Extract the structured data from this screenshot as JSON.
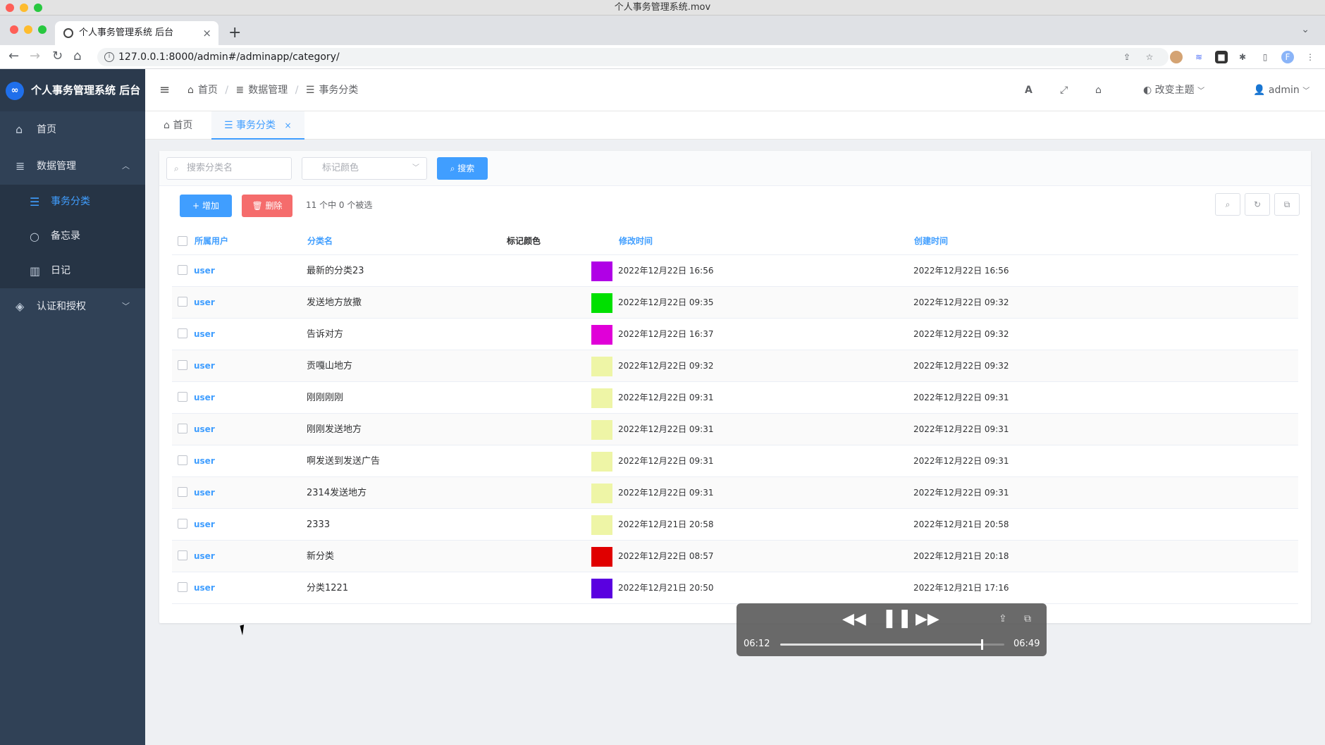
{
  "window": {
    "title": "个人事务管理系统.mov"
  },
  "browser": {
    "tab_title": "个人事务管理系统 后台",
    "url": "127.0.0.1:8000/admin#/adminapp/category/"
  },
  "app": {
    "logo_text": "个人事务管理系统 后台",
    "sidebar": {
      "items": [
        {
          "label": "首页",
          "icon": "home-icon"
        },
        {
          "label": "数据管理",
          "icon": "database-icon",
          "expanded": true,
          "children": [
            {
              "label": "事务分类",
              "icon": "list-icon",
              "active": true
            },
            {
              "label": "备忘录",
              "icon": "circle-icon"
            },
            {
              "label": "日记",
              "icon": "book-icon"
            }
          ]
        },
        {
          "label": "认证和授权",
          "icon": "shield-icon"
        }
      ]
    },
    "breadcrumb": [
      "首页",
      "数据管理",
      "事务分类"
    ],
    "header_right": {
      "theme_label": "改变主题",
      "user": "admin",
      "font_icon": "A"
    },
    "tags": [
      {
        "label": "首页"
      },
      {
        "label": "事务分类",
        "active": true
      }
    ],
    "filters": {
      "search_placeholder": "搜索分类名",
      "color_placeholder": "标记颜色",
      "search_button": "搜索"
    },
    "actions": {
      "add": "增加",
      "delete": "删除",
      "selection_info": "11 个中 0 个被选"
    },
    "table": {
      "headers": [
        "所属用户",
        "分类名",
        "标记颜色",
        "修改时间",
        "创建时间"
      ],
      "rows": [
        {
          "user": "user",
          "name": "最新的分类23",
          "color": "#b000e6",
          "modified": "2022年12月22日 16:56",
          "created": "2022年12月22日 16:56"
        },
        {
          "user": "user",
          "name": "发送地方放撒",
          "color": "#00e000",
          "modified": "2022年12月22日 09:35",
          "created": "2022年12月22日 09:32"
        },
        {
          "user": "user",
          "name": "告诉对方",
          "color": "#e000d8",
          "modified": "2022年12月22日 16:37",
          "created": "2022年12月22日 09:32"
        },
        {
          "user": "user",
          "name": "贡嘎山地方",
          "color": "#eef5a6",
          "modified": "2022年12月22日 09:32",
          "created": "2022年12月22日 09:32"
        },
        {
          "user": "user",
          "name": "刚刚刚刚",
          "color": "#eef5a6",
          "modified": "2022年12月22日 09:31",
          "created": "2022年12月22日 09:31"
        },
        {
          "user": "user",
          "name": "刚刚发送地方",
          "color": "#eef5a6",
          "modified": "2022年12月22日 09:31",
          "created": "2022年12月22日 09:31"
        },
        {
          "user": "user",
          "name": "啊发送到发送广告",
          "color": "#eef5a6",
          "modified": "2022年12月22日 09:31",
          "created": "2022年12月22日 09:31"
        },
        {
          "user": "user",
          "name": "2314发送地方",
          "color": "#eef5a6",
          "modified": "2022年12月22日 09:31",
          "created": "2022年12月22日 09:31"
        },
        {
          "user": "user",
          "name": "2333",
          "color": "#eef5a6",
          "modified": "2022年12月21日 20:58",
          "created": "2022年12月21日 20:58"
        },
        {
          "user": "user",
          "name": "新分类",
          "color": "#e00000",
          "modified": "2022年12月22日 08:57",
          "created": "2022年12月21日 20:18"
        },
        {
          "user": "user",
          "name": "分类1221",
          "color": "#5a00e0",
          "modified": "2022年12月21日 20:50",
          "created": "2022年12月21日 17:16"
        }
      ]
    }
  },
  "video": {
    "elapsed": "06:12",
    "remaining": "06:49",
    "progress": 0.9
  },
  "colors": {
    "primary": "#409eff",
    "danger": "#f56c6c",
    "sidebar": "#304156"
  }
}
